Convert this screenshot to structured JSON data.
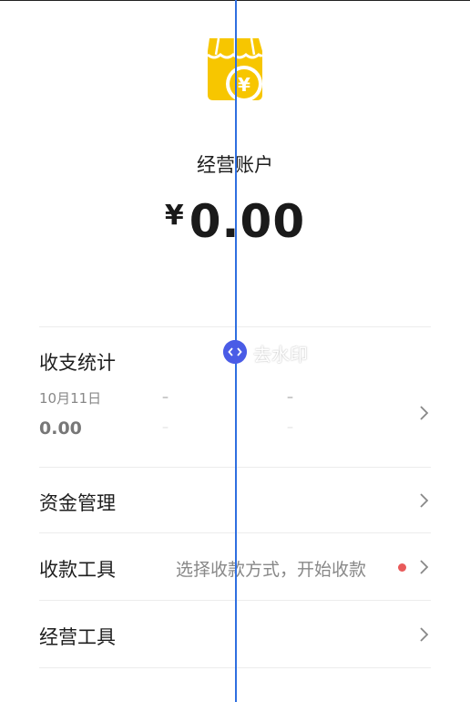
{
  "account": {
    "title": "经营账户",
    "currency_symbol": "¥",
    "balance": "0.00"
  },
  "stats": {
    "title": "收支统计",
    "date": "10月11日",
    "value": "0.00",
    "dash": "–"
  },
  "menu": {
    "funds_label": "资金管理",
    "collect_label": "收款工具",
    "collect_hint": "选择收款方式，开始收款",
    "business_label": "经营工具"
  },
  "watermark": "去水印",
  "colors": {
    "icon_yellow": "#F7C600",
    "accent_blue": "#2F6FE0",
    "handle_blue": "#4A5CE6",
    "dot_red": "#E85A5A"
  },
  "icons": [
    "shop-coin-icon",
    "chevron-right-icon",
    "split-handle-icon"
  ]
}
